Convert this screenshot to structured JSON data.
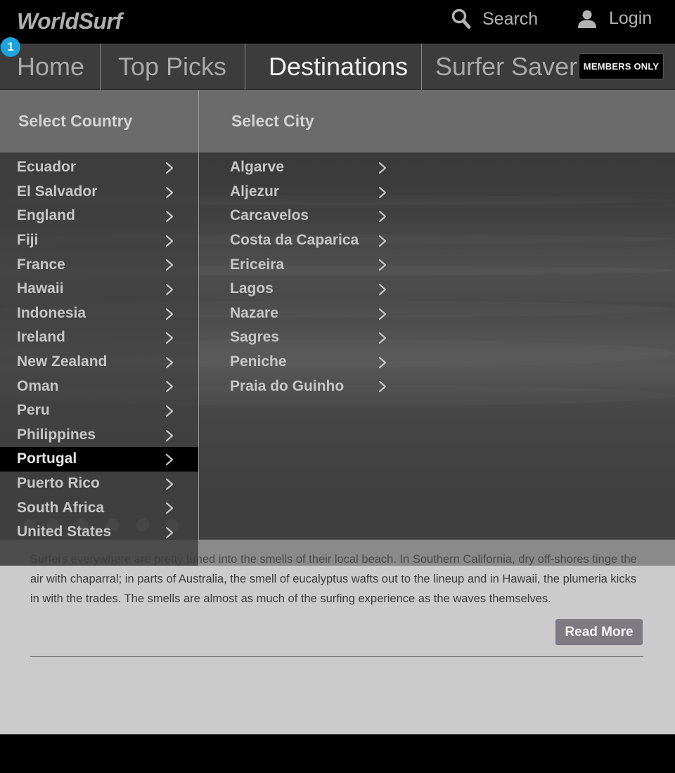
{
  "header": {
    "logo": "WorldSurf",
    "search_label": "Search",
    "login_label": "Login"
  },
  "nav": {
    "items": [
      {
        "label": "Home"
      },
      {
        "label": "Top Picks"
      },
      {
        "label": "Destinations"
      },
      {
        "label": "Surfer Saver"
      }
    ],
    "active": "Destinations",
    "members_badge": "MEMBERS ONLY",
    "notification_count": "1"
  },
  "dropdown": {
    "country_title": "Select Country",
    "city_title": "Select City",
    "countries": [
      "Ecuador",
      "El Salvador",
      "England",
      "Fiji",
      "France",
      "Hawaii",
      "Indonesia",
      "Ireland",
      "New Zealand",
      "Oman",
      "Peru",
      "Philippines",
      "Portugal",
      "Puerto Rico",
      "South Africa",
      "United States"
    ],
    "selected_country": "Portugal",
    "cities": [
      "Algarve",
      "Aljezur",
      "Carcavelos",
      "Costa da Caparica",
      "Ericeira",
      "Lagos",
      "Nazare",
      "Sagres",
      "Peniche",
      "Praia do Guinho"
    ]
  },
  "article": {
    "text": "Surfers everywhere are pretty tuned into the smells of their local beach. In Southern California, dry off-shores tinge the air with chaparral; in parts of Australia, the smell of eucalyptus wafts out to the lineup and in Hawaii, the plumeria kicks in with the trades. The smells are almost as much of the surfing experience as the waves themselves.",
    "read_more_label": "Read More"
  },
  "colors": {
    "accent_badge": "#1da4dc",
    "selected_row": "#000000"
  },
  "icons": {
    "search": "search-icon",
    "login": "user-icon",
    "chevron": "chevron-right-icon"
  }
}
